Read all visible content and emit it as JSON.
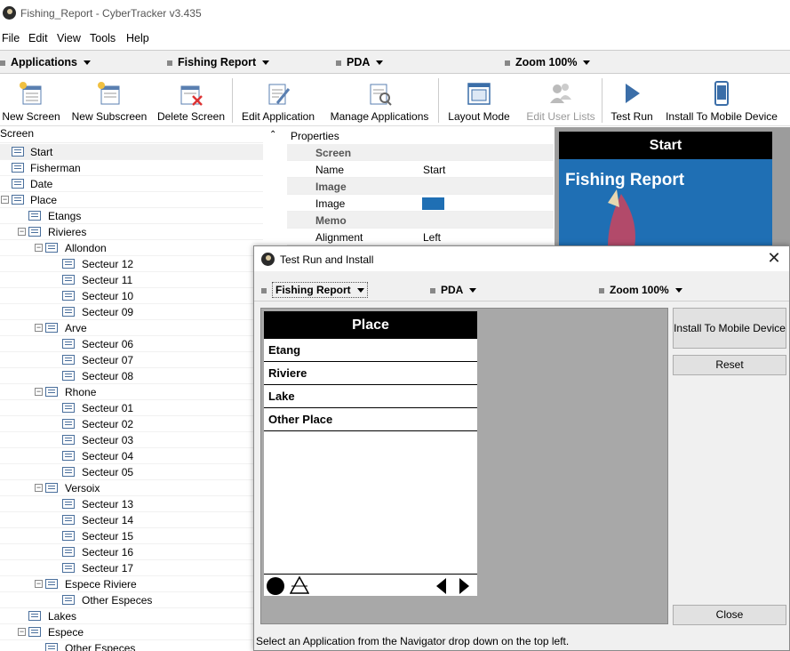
{
  "window": {
    "title": "Fishing_Report - CyberTracker v3.435"
  },
  "menu": [
    "File",
    "Edit",
    "View",
    "Tools",
    "Help"
  ],
  "selectors": {
    "applications": "Applications",
    "app": "Fishing Report",
    "device": "PDA",
    "zoom": "Zoom 100%"
  },
  "toolbar": [
    {
      "label": "New Screen",
      "icon": "new-screen-icon"
    },
    {
      "label": "New Subscreen",
      "icon": "new-subscreen-icon"
    },
    {
      "label": "Delete Screen",
      "icon": "delete-screen-icon"
    },
    {
      "label": "Edit Application",
      "icon": "edit-application-icon"
    },
    {
      "label": "Manage Applications",
      "icon": "manage-applications-icon"
    },
    {
      "label": "Layout Mode",
      "icon": "layout-mode-icon"
    },
    {
      "label": "Edit User Lists",
      "icon": "users-icon",
      "disabled": true
    },
    {
      "label": "Test Run",
      "icon": "play-icon"
    },
    {
      "label": "Install To Mobile Device",
      "icon": "mobile-device-icon"
    }
  ],
  "tree": {
    "header": "Screen",
    "items": [
      {
        "label": "Start",
        "level": 0,
        "selected": true
      },
      {
        "label": "Fisherman",
        "level": 0
      },
      {
        "label": "Date",
        "level": 0
      },
      {
        "label": "Place",
        "level": 0,
        "expanded": true
      },
      {
        "label": "Etangs",
        "level": 1
      },
      {
        "label": "Rivieres",
        "level": 1,
        "expanded": true
      },
      {
        "label": "Allondon",
        "level": 2,
        "expanded": true
      },
      {
        "label": "Secteur 12",
        "level": 3
      },
      {
        "label": "Secteur 11",
        "level": 3
      },
      {
        "label": "Secteur 10",
        "level": 3
      },
      {
        "label": "Secteur 09",
        "level": 3
      },
      {
        "label": "Arve",
        "level": 2,
        "expanded": true
      },
      {
        "label": "Secteur 06",
        "level": 3
      },
      {
        "label": "Secteur 07",
        "level": 3
      },
      {
        "label": "Secteur 08",
        "level": 3
      },
      {
        "label": "Rhone",
        "level": 2,
        "expanded": true
      },
      {
        "label": "Secteur 01",
        "level": 3
      },
      {
        "label": "Secteur 02",
        "level": 3
      },
      {
        "label": "Secteur 03",
        "level": 3
      },
      {
        "label": "Secteur 04",
        "level": 3
      },
      {
        "label": "Secteur 05",
        "level": 3
      },
      {
        "label": "Versoix",
        "level": 2,
        "expanded": true
      },
      {
        "label": "Secteur 13",
        "level": 3
      },
      {
        "label": "Secteur 14",
        "level": 3
      },
      {
        "label": "Secteur 15",
        "level": 3
      },
      {
        "label": "Secteur 16",
        "level": 3
      },
      {
        "label": "Secteur 17",
        "level": 3
      },
      {
        "label": "Espece Riviere",
        "level": 2,
        "expanded": true
      },
      {
        "label": "Other Especes",
        "level": 3
      },
      {
        "label": "Lakes",
        "level": 1
      },
      {
        "label": "Espece",
        "level": 1,
        "expanded": true
      },
      {
        "label": "Other Especes",
        "level": 2
      }
    ]
  },
  "properties": {
    "header": "Properties",
    "rows": [
      {
        "group": "Screen"
      },
      {
        "key": "Name",
        "value": "Start"
      },
      {
        "group": "Image"
      },
      {
        "key": "Image",
        "value": ""
      },
      {
        "group": "Memo"
      },
      {
        "key": "Alignment",
        "value": "Left"
      }
    ]
  },
  "preview": {
    "header": "Start",
    "title": "Fishing Report"
  },
  "dialog": {
    "title": "Test Run and Install",
    "selectors": {
      "app": "Fishing Report",
      "device": "PDA",
      "zoom": "Zoom 100%"
    },
    "screen_title": "Place",
    "items": [
      "Etang",
      "Riviere",
      "Lake",
      "Other Place"
    ],
    "buttons": {
      "install": "Install To Mobile Device",
      "reset": "Reset",
      "close": "Close"
    },
    "status": "Select an Application from the Navigator drop down on the top left."
  }
}
